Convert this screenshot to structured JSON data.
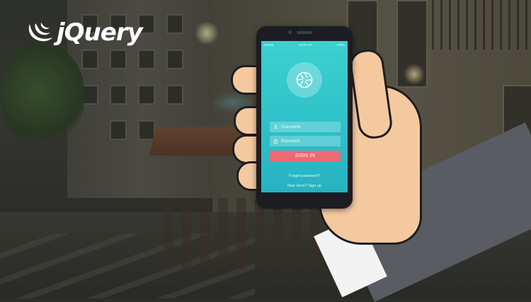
{
  "brand": {
    "logo_text": "jQuery",
    "logo_icon": "jquery-swoosh-icon"
  },
  "phone": {
    "status": {
      "carrier": "Mobile",
      "time": "12:00 AM",
      "battery": "100%"
    },
    "app_icon": "aperture-icon",
    "username_placeholder": "Username",
    "password_placeholder": "Password",
    "signin_label": "SIGN IN",
    "forgot_label": "Forgot password?",
    "signup_label": "New Here? Sign up"
  },
  "colors": {
    "screen_top": "#3bd1cf",
    "screen_bottom": "#27b2c2",
    "signin_button": "#ee6a72",
    "skin": "#f5c9a0",
    "sleeve": "#5a5c63",
    "cuff": "#f3f3f3"
  }
}
